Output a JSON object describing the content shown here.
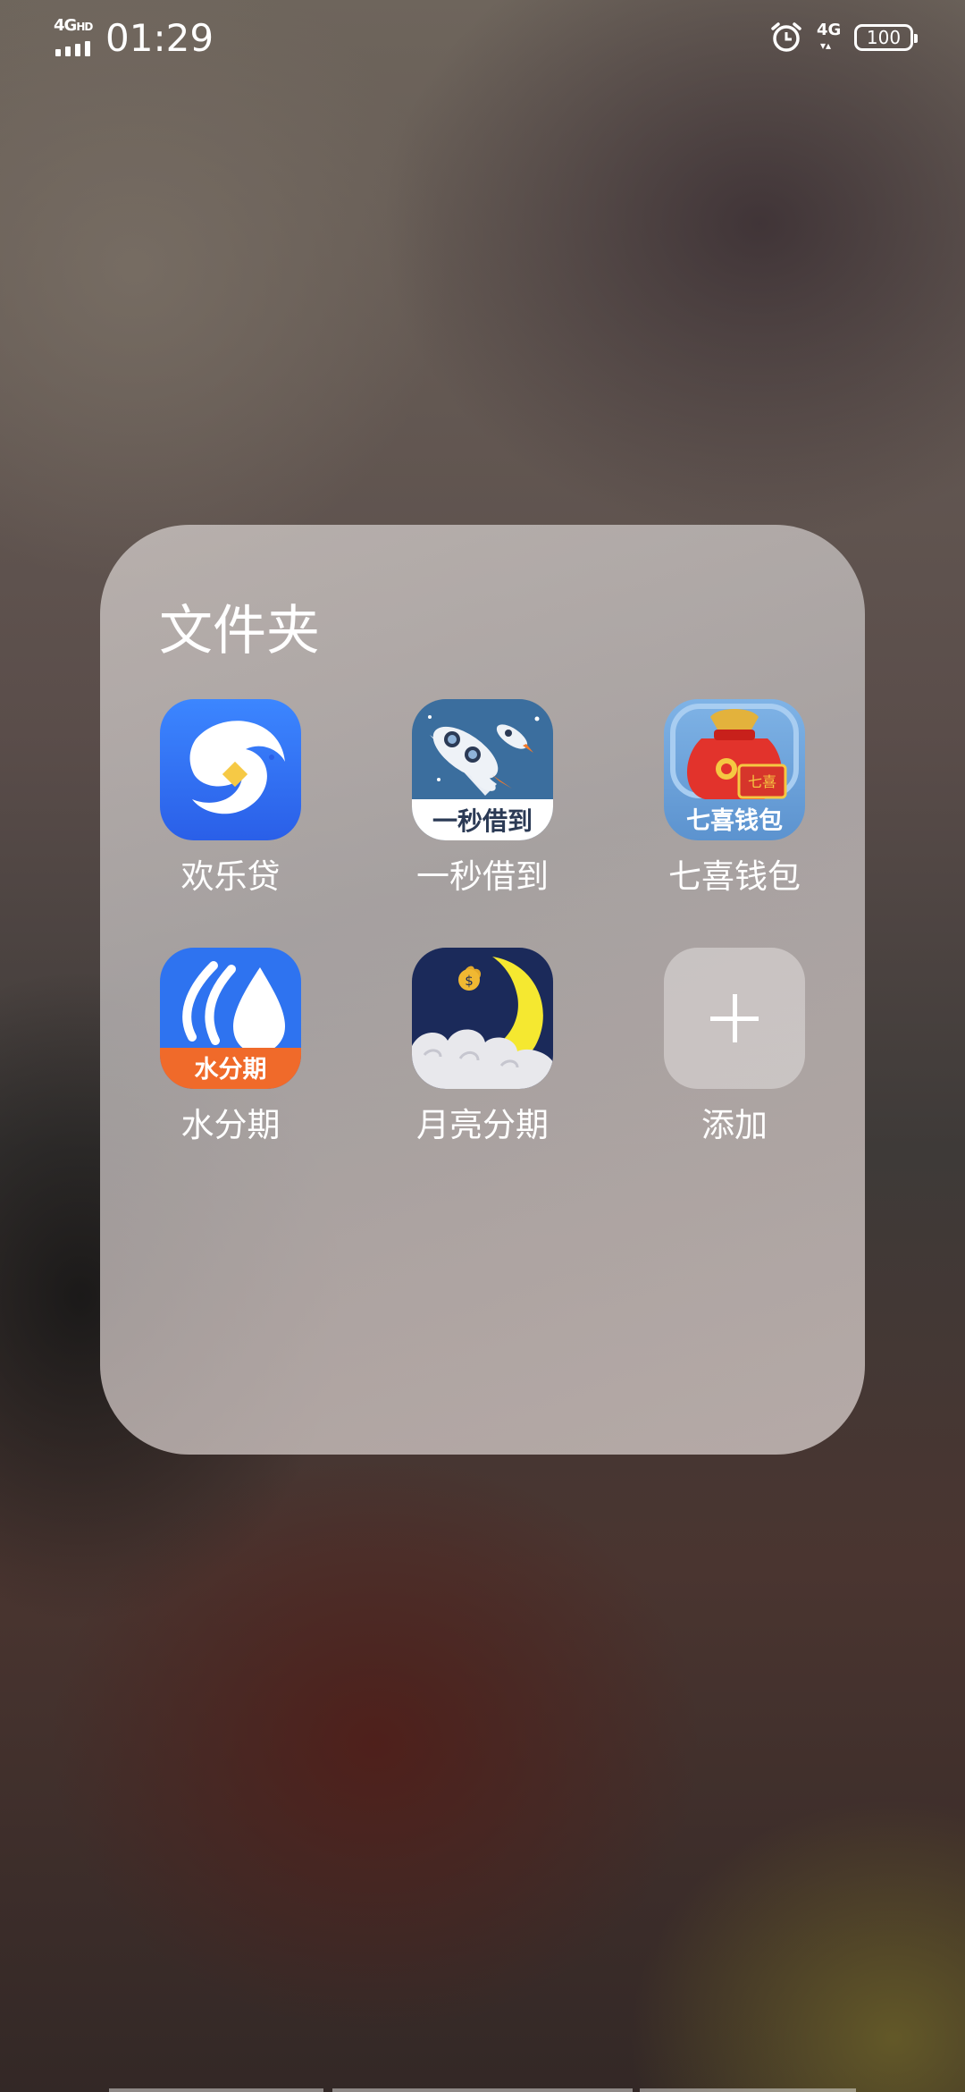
{
  "status_bar": {
    "network_left": "4G",
    "network_left_suffix": "HD",
    "time": "01:29",
    "network_right": "4G",
    "battery": "100"
  },
  "folder": {
    "title": "文件夹",
    "apps": [
      {
        "label": "欢乐贷",
        "icon": "dolphin-coin-icon"
      },
      {
        "label": "一秒借到",
        "icon": "rocket-icon",
        "icon_text": "一秒借到"
      },
      {
        "label": "七喜钱包",
        "icon": "red-money-bag-icon",
        "icon_text": "七喜钱包"
      },
      {
        "label": "水分期",
        "icon": "water-drop-icon",
        "icon_text": "水分期"
      },
      {
        "label": "月亮分期",
        "icon": "moon-icon"
      },
      {
        "label": "添加",
        "icon": "plus-icon"
      }
    ]
  },
  "colors": {
    "huanledai_blue": "#2f6df2",
    "rocket_bg": "#3b6e9e",
    "qixi_bg": "#74a8dc",
    "water_blue": "#2e73f0",
    "water_orange": "#f06a2a",
    "moon_navy": "#1b2a5a",
    "moon_yellow": "#f5e830"
  }
}
